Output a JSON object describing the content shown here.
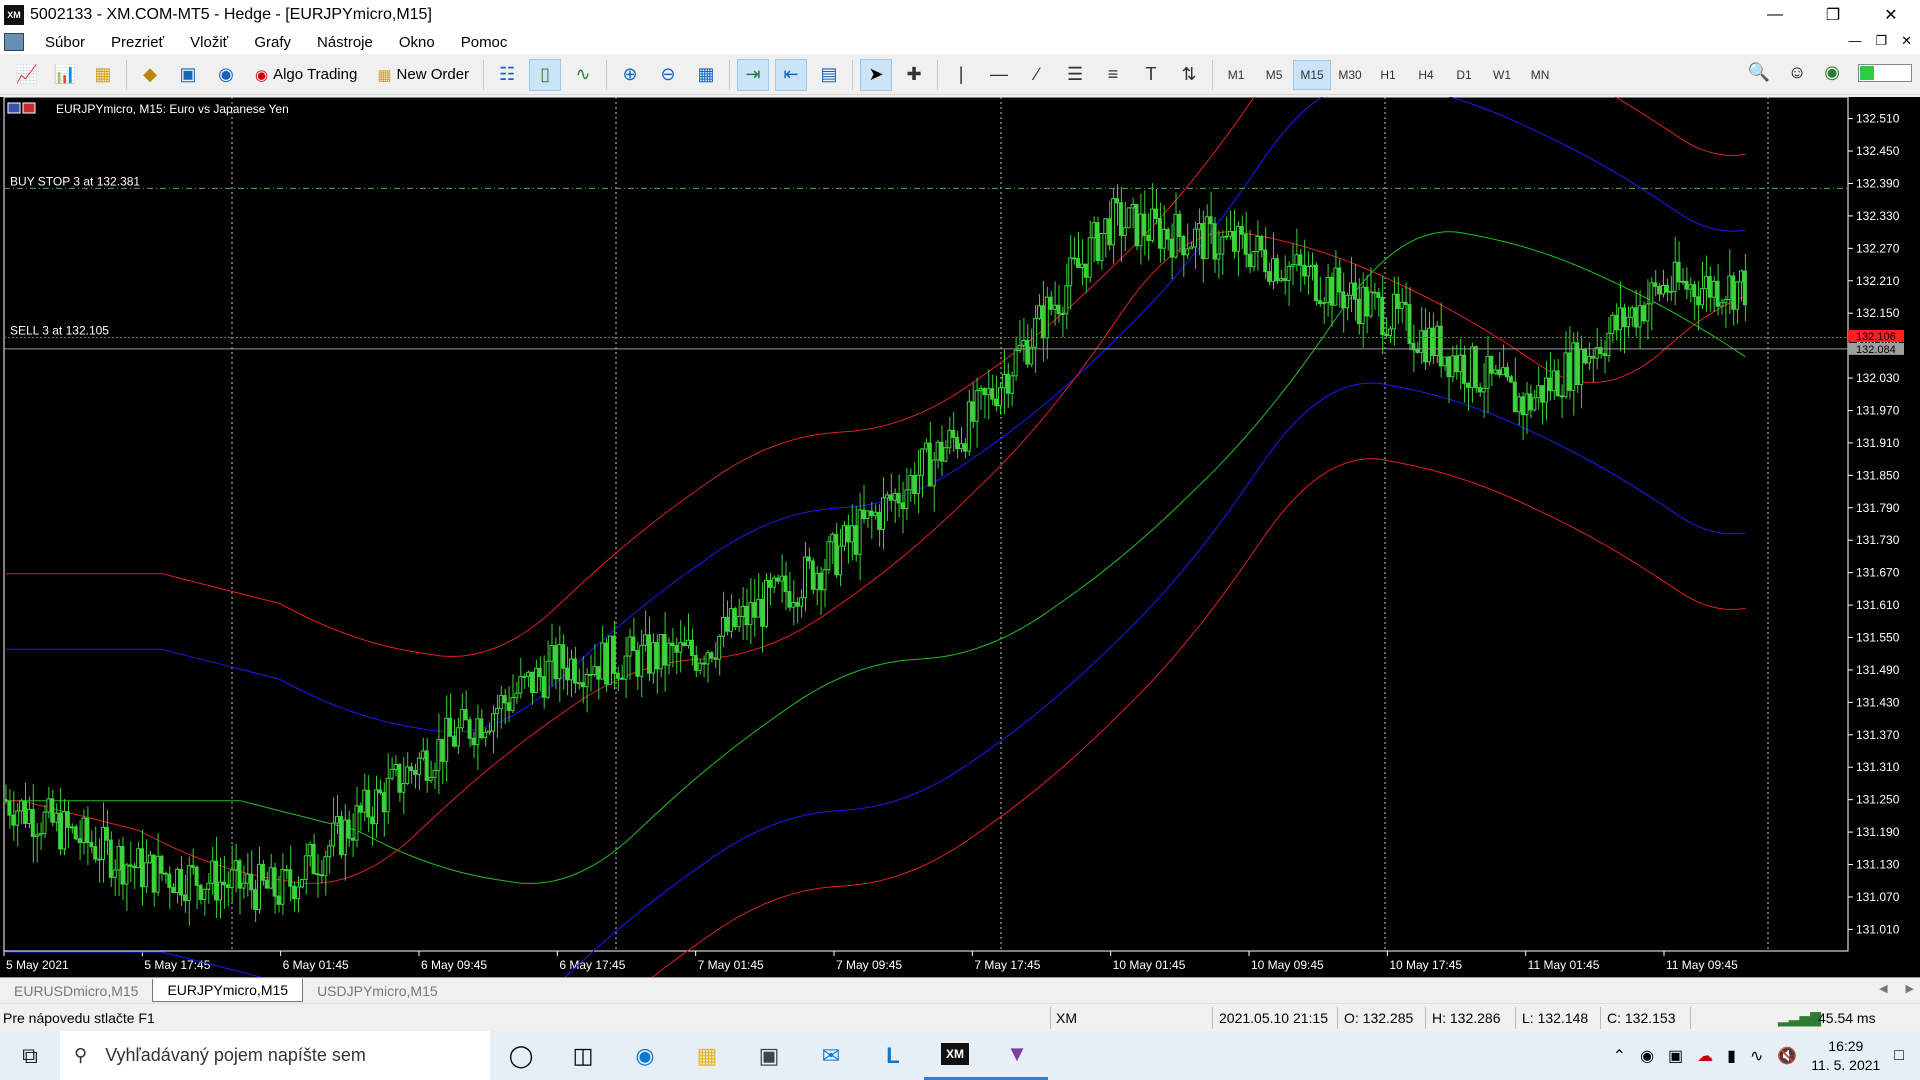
{
  "window": {
    "title": "5002133 - XM.COM-MT5 - Hedge - [EURJPYmicro,M15]",
    "app_icon": "XM"
  },
  "menu": [
    "Súbor",
    "Prezrieť",
    "Vložiť",
    "Grafy",
    "Nástroje",
    "Okno",
    "Pomoc"
  ],
  "toolbar": {
    "algo_label": "Algo Trading",
    "order_label": "New Order",
    "timeframes": [
      "M1",
      "M5",
      "M15",
      "M30",
      "H1",
      "H4",
      "D1",
      "W1",
      "MN"
    ],
    "active_timeframe": "M15"
  },
  "chart": {
    "header": "EURJPYmicro, M15:  Euro vs Japanese Yen",
    "price_ticks": [
      "132.510",
      "132.450",
      "132.390",
      "132.330",
      "132.270",
      "132.210",
      "132.150",
      "132.090",
      "132.030",
      "131.970",
      "131.910",
      "131.850",
      "131.790",
      "131.730",
      "131.670",
      "131.610",
      "131.550",
      "131.490",
      "131.430",
      "131.370",
      "131.310",
      "131.250",
      "131.190",
      "131.130",
      "131.070",
      "131.010"
    ],
    "time_ticks": [
      "5 May 2021",
      "5 May 17:45",
      "6 May 01:45",
      "6 May 09:45",
      "6 May 17:45",
      "7 May 01:45",
      "7 May 09:45",
      "7 May 17:45",
      "10 May 01:45",
      "10 May 09:45",
      "10 May 17:45",
      "11 May 01:45",
      "11 May 09:45"
    ],
    "order_lines": [
      {
        "label": "BUY STOP 3 at 132.381",
        "price": 132.381,
        "color": "#4caf50"
      },
      {
        "label": "SELL 3 at 132.105",
        "price": 132.105,
        "color": "#ff3b3b"
      }
    ],
    "bid_tag": "132.106",
    "ask_tag": "132.084",
    "colors": {
      "candles": "#3cd23c",
      "bb_red": "#e02020",
      "bb_blue": "#1a1aff",
      "bb_green": "#20c020",
      "grid": "#c8c8c8"
    }
  },
  "chart_data": {
    "type": "line",
    "title": "",
    "xlabel": "",
    "ylabel": "",
    "ylim": [
      130.97,
      132.55
    ],
    "x": [
      "5 May 2021",
      "5 May 17:45",
      "6 May 01:45",
      "6 May 09:45",
      "6 May 17:45",
      "7 May 01:45",
      "7 May 09:45",
      "7 May 17:45",
      "10 May 01:45",
      "10 May 09:45",
      "10 May 17:45",
      "11 May 01:45",
      "11 May 09:45"
    ],
    "series": [
      {
        "values": [
          131.25,
          131.12,
          131.08,
          131.32,
          131.5,
          131.52,
          131.7,
          131.95,
          132.32,
          132.27,
          132.15,
          131.98,
          132.2
        ]
      }
    ]
  },
  "tabs": [
    {
      "label": "EURUSDmicro,M15",
      "active": false
    },
    {
      "label": "EURJPYmicro,M15",
      "active": true
    },
    {
      "label": "USDJPYmicro,M15",
      "active": false
    }
  ],
  "status": {
    "help": "Pre nápovedu stlačte F1",
    "profile": "XM",
    "datetime": "2021.05.10 21:15",
    "open": "O: 132.285",
    "high": "H: 132.286",
    "low": "L: 132.148",
    "close": "C: 132.153",
    "ping": "45.54 ms"
  },
  "taskbar": {
    "search_placeholder": "Vyhľadávaný pojem napíšte sem",
    "time": "16:29",
    "date": "11. 5. 2021",
    "xm_label": "XM"
  }
}
